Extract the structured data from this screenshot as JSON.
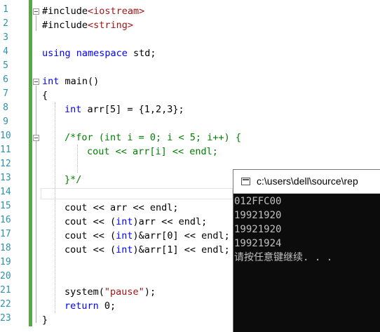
{
  "editor": {
    "line_numbers": [
      "1",
      "2",
      "3",
      "4",
      "5",
      "6",
      "7",
      "8",
      "9",
      "10",
      "11",
      "12",
      "13",
      "14",
      "15",
      "16",
      "17",
      "18",
      "19",
      "20",
      "21",
      "22",
      "23"
    ],
    "code": {
      "l1_pre": "#include",
      "l1_str": "<iostream>",
      "l2_pre": "#include",
      "l2_str": "<string>",
      "l4_kw": "using namespace",
      "l4_rest": " std;",
      "l6_kw": "int",
      "l6_rest": " main()",
      "l7": "{",
      "l8_kw": "int",
      "l8_rest": " arr[5] = {1,2,3};",
      "l10": "/*for (int i = 0; i < 5; i++) {",
      "l11": "cout << arr[i] << endl;",
      "l13": "}*/",
      "l15": "cout << arr << endl;",
      "l16_a": "cout << (",
      "l16_kw": "int",
      "l16_b": ")arr << endl;",
      "l17_a": "cout << (",
      "l17_kw": "int",
      "l17_b": ")&arr[0] << endl;",
      "l18_a": "cout << (",
      "l18_kw": "int",
      "l18_b": ")&arr[1] << endl;",
      "l21_a": "system(",
      "l21_str": "\"pause\"",
      "l21_b": ");",
      "l22_kw": "return",
      "l22_rest": " 0;",
      "l23": "}"
    }
  },
  "console": {
    "title": "c:\\users\\dell\\source\\rep",
    "output": [
      "012FFC00",
      "19921920",
      "19921920",
      "19921924",
      "请按任意键继续. . ."
    ]
  },
  "colors": {
    "keyword": "#0000ff",
    "string": "#a31515",
    "comment": "#008000",
    "line_number": "#2b91af",
    "change_bar": "#57a64a",
    "console_bg": "#0c0c0c",
    "console_text": "#c0c0c0"
  }
}
